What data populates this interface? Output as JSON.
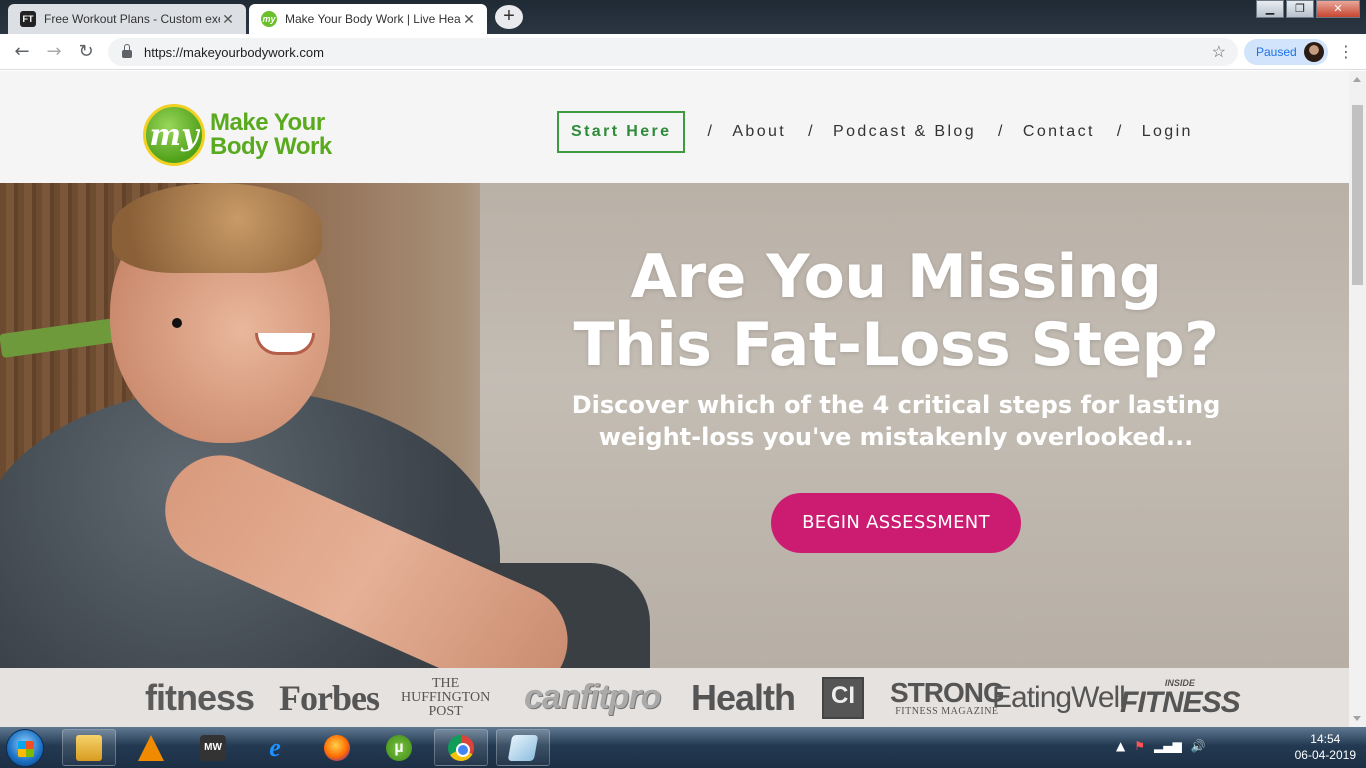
{
  "browser": {
    "tabs": [
      {
        "favicon_text": "FT",
        "title": "Free Workout Plans - Custom exe",
        "active": false
      },
      {
        "favicon_text": "my",
        "title": "Make Your Body Work | Live Hea",
        "active": true
      }
    ],
    "new_tab_symbol": "+",
    "window_controls": {
      "minimize": "▁",
      "maximize": "❐",
      "close": "✕"
    },
    "url": "https://makeyourbodywork.com",
    "profile_status": "Paused",
    "icons": {
      "back": "arrow-left",
      "forward": "arrow-right",
      "reload": "reload",
      "bookmark": "star",
      "menu": "kebab"
    }
  },
  "site": {
    "logo": {
      "mark": "my",
      "line1": "Make Your",
      "line2": "Body Work"
    },
    "nav": {
      "start_here": "Start Here",
      "separator": "/",
      "items": [
        "About",
        "Podcast & Blog",
        "Contact",
        "Login"
      ]
    },
    "hero": {
      "title_line1": "Are You Missing",
      "title_line2": "This Fat-Loss Step?",
      "subtitle_line1": "Discover which of the 4 critical steps for lasting",
      "subtitle_line2": "weight-loss you've mistakenly overlooked...",
      "cta_label": "BEGIN ASSESSMENT",
      "cta_color": "#cc1c72"
    },
    "press_logos": {
      "fitness": "fitness",
      "forbes": "Forbes",
      "huffington_line1": "THE",
      "huffington_line2": "HUFFINGTON",
      "huffington_line3": "POST",
      "canfitpro": "canfitpro",
      "health": "Health",
      "ci": "CI",
      "strong": "STRONG",
      "strong_sub": "FITNESS MAGAZINE",
      "eatingwell": "EatingWell",
      "inside": "INSIDE",
      "inside_fitness": "FITNESS"
    },
    "brand_green": "#5aaa1f",
    "nav_border_green": "#3e9a3e"
  },
  "taskbar": {
    "apps": [
      "windows-explorer",
      "vlc",
      "mw",
      "internet-explorer",
      "firefox",
      "utorrent",
      "chrome",
      "sheet-app"
    ],
    "mw_label": "MW",
    "ut_label": "µ",
    "ie_label": "e",
    "time": "14:54",
    "date": "06-04-2019",
    "tray_glyphs": {
      "expand": "▲",
      "flag": "⚑",
      "network": "▂▄▆",
      "volume": "🔊"
    }
  }
}
